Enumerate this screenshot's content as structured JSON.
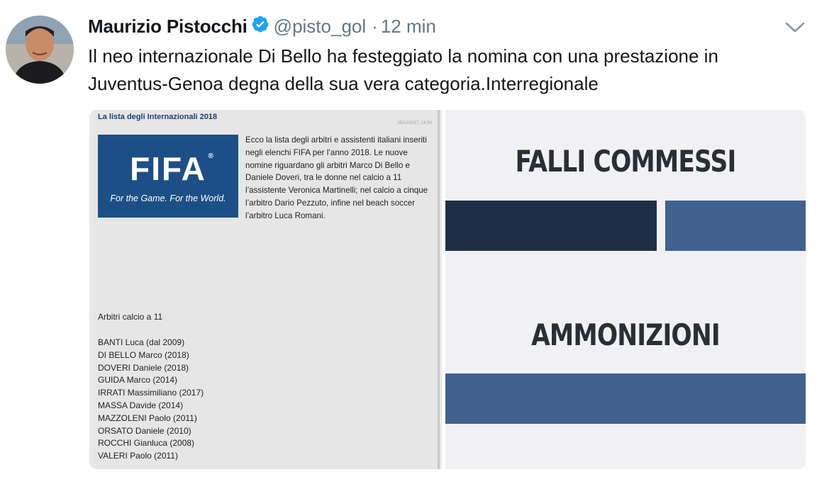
{
  "tweet": {
    "author_name": "Maurizio Pistocchi",
    "handle": "@pisto_gol",
    "separator": "·",
    "time": "12 min",
    "text": "Il neo internazionale Di Bello ha festeggiato la nomina con una prestazione in Juventus-Genoa degna della sua vera categoria.Interregionale"
  },
  "media": {
    "article": {
      "title": "La lista degli Internazionali 2018",
      "date": "05/12/2017, 14:50",
      "logo_text": "FIFA",
      "logo_reg": "®",
      "slogan": "For the Game. For the World.",
      "paragraph": "Ecco la lista degli arbitri e assistenti italiani inseriti negli elenchi FIFA per l’anno 2018. Le nuove nomine riguardano gli arbitri Marco Di Bello e Daniele Doveri, tra le donne nel calcio a 11 l’assistente Veronica Martinelli; nel calcio a cinque l’arbitro Dario Pezzuto, infine nel beach soccer l’arbitro Luca Romani.",
      "subheading": "Arbitri calcio a 11",
      "referees": [
        "BANTI Luca (dal 2009)",
        "DI BELLO Marco (2018)",
        "DOVERI Daniele (2018)",
        "GUIDA Marco (2014)",
        "IRRATI Massimiliano (2017)",
        "MASSA Davide (2014)",
        "MAZZOLENI Paolo (2011)",
        "ORSATO Daniele (2010)",
        "ROCCHI Gianluca (2008)",
        "VALERI Paolo (2011)"
      ]
    },
    "stats": {
      "title_1": "FALLI COMMESSI",
      "title_2": "AMMONIZIONI"
    }
  },
  "colors": {
    "verified": "#1da1f2",
    "bar_dark": "#1f2e45",
    "bar_blue": "#41628f",
    "fifa_blue": "#1d4f86"
  },
  "icons": {
    "verified": "verified-badge-icon",
    "chevron": "chevron-down-icon"
  }
}
